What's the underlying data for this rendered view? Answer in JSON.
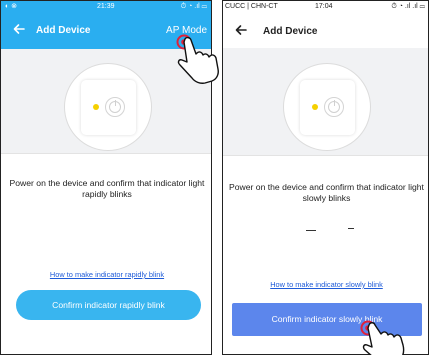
{
  "left_screen": {
    "status_bar": {
      "left_icons": "◐ ⊗",
      "time": "21:39",
      "right_icons": "⏱ ◔ .ıl ▭"
    },
    "header": {
      "back_icon": "arrow-left-icon",
      "title": "Add Device",
      "action_label": "AP Mode"
    },
    "instruction": "Power on the device and confirm that indicator light rapidly blinks",
    "help_link": "How to make indicator rapidly blink",
    "confirm_button": "Confirm indicator rapidly blink",
    "colors": {
      "primary": "#2aaef0",
      "button": "#39b5ef",
      "link": "#1e5bd8",
      "led": "#f5d000",
      "tap_marker": "#e0203a"
    }
  },
  "right_screen": {
    "status_bar": {
      "carrier": "CUCC | CHN-CT",
      "time": "17:04",
      "right_icons": "⏱ ◔ .ıl .ıl ▭"
    },
    "header": {
      "back_icon": "arrow-left-icon",
      "title": "Add Device"
    },
    "instruction": "Power on the device and confirm that indicator light slowly blinks",
    "help_link": "How to make indicator slowly blink",
    "confirm_button": "Confirm indicator slowly blink",
    "colors": {
      "button": "#5c86ec",
      "link": "#1e5bd8",
      "led": "#f5d000",
      "tap_marker": "#e0203a"
    }
  }
}
